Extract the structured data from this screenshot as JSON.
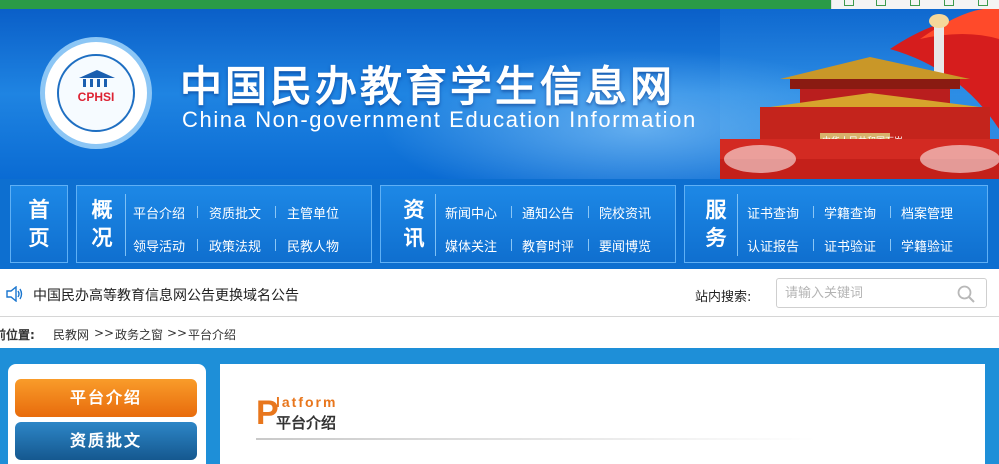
{
  "header": {
    "title_cn": "中国民办教育学生信息网",
    "title_en": "China Non-government Education Information",
    "logo_text": "CPHSI",
    "tiananmen_banner_text": "中华人民共和国万岁"
  },
  "nav": {
    "home": "首页",
    "group1": {
      "label": "概况",
      "row1": [
        "平台介绍",
        "资质批文",
        "主管单位"
      ],
      "row2": [
        "领导活动",
        "政策法规",
        "民教人物"
      ]
    },
    "group2": {
      "label": "资讯",
      "row1": [
        "新闻中心",
        "通知公告",
        "院校资讯"
      ],
      "row2": [
        "媒体关注",
        "教育时评",
        "要闻博览"
      ]
    },
    "group3": {
      "label": "服务",
      "row1": [
        "证书查询",
        "学籍查询",
        "档案管理"
      ],
      "row2": [
        "认证报告",
        "证书验证",
        "学籍验证"
      ]
    }
  },
  "notice": {
    "text": "中国民办高等教育信息网公告更换域名公告",
    "search_label": "站内搜索:",
    "search_placeholder": "请输入关键词"
  },
  "breadcrumb": {
    "label": "前位置:",
    "items": [
      "民教网",
      ">>",
      "政务之窗",
      ">>",
      "平台介绍"
    ]
  },
  "sidebar": {
    "items": [
      {
        "label": "平台介绍",
        "color": "#f07a10"
      },
      {
        "label": "资质批文",
        "color": "#1f6aa6"
      }
    ]
  },
  "main": {
    "heading_en_initial": "P",
    "heading_en_rest": "latform",
    "heading_cn": "平台介绍"
  },
  "colors": {
    "top_bar": "#2a9b47",
    "banner": "#1479d9",
    "nav_bg": "#0d6fd0",
    "content_bg": "#1e8fd8",
    "accent_orange": "#f07a10"
  }
}
